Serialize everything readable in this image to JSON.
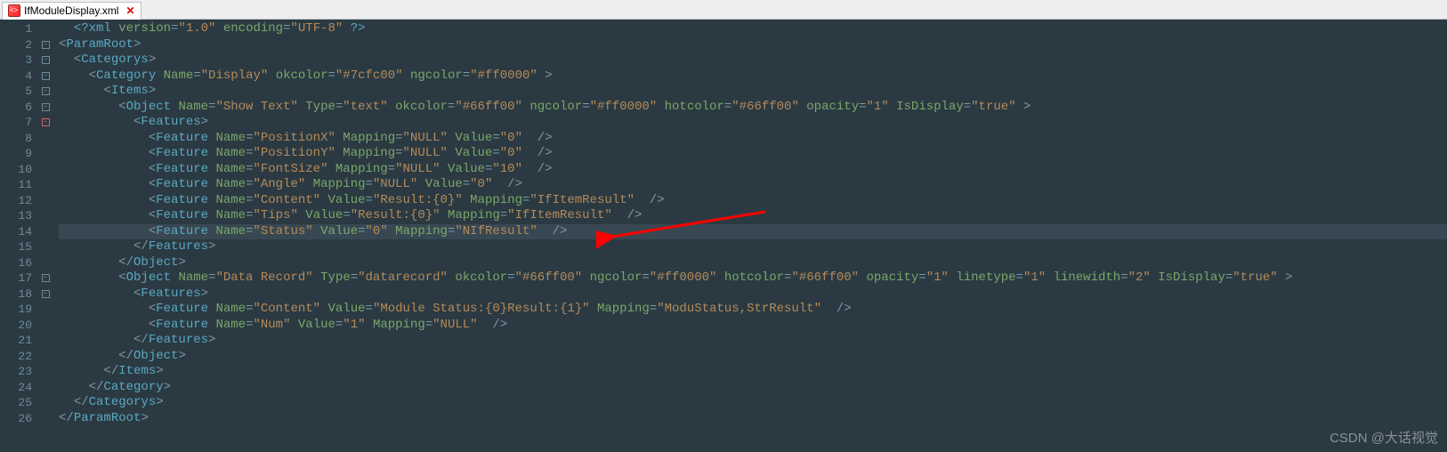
{
  "tab": {
    "filename": "IfModuleDisplay.xml",
    "close": "✕"
  },
  "lineNumbers": [
    "1",
    "2",
    "3",
    "4",
    "5",
    "6",
    "7",
    "8",
    "9",
    "10",
    "11",
    "12",
    "13",
    "14",
    "15",
    "16",
    "17",
    "18",
    "19",
    "20",
    "21",
    "22",
    "23",
    "24",
    "25",
    "26"
  ],
  "fold": [
    "",
    "⊟",
    "⊟",
    "⊟",
    "⊟",
    "⊟",
    "⊟",
    "",
    "",
    "",
    "",
    "",
    "",
    "",
    "",
    "",
    "⊟",
    "⊟",
    "",
    "",
    "",
    "",
    "",
    "",
    "",
    ""
  ],
  "highlightLine": 14,
  "code": {
    "l1": {
      "pre": "  ",
      "xml": "<?xml ",
      "a1": "version",
      "v1": "\"1.0\"",
      "a2": "encoding",
      "v2": "\"UTF-8\"",
      "end": "?>"
    },
    "l2": {
      "open": "<",
      "tag": "ParamRoot",
      "close": ">"
    },
    "l3": {
      "indent": "  ",
      "open": "<",
      "tag": "Categorys",
      "close": ">"
    },
    "l4": {
      "indent": "    ",
      "open": "<",
      "tag": "Category ",
      "a1": "Name",
      "v1": "\"Display\"",
      "a2": "okcolor",
      "v2": "\"#7cfc00\"",
      "a3": "ngcolor",
      "v3": "\"#ff0000\"",
      "close": ">"
    },
    "l5": {
      "indent": "      ",
      "open": "<",
      "tag": "Items",
      "close": ">"
    },
    "l6": {
      "indent": "        ",
      "open": "<",
      "tag": "Object ",
      "a1": "Name",
      "v1": "\"Show Text\"",
      "a2": "Type",
      "v2": "\"text\"",
      "a3": "okcolor",
      "v3": "\"#66ff00\"",
      "a4": "ngcolor",
      "v4": "\"#ff0000\"",
      "a5": "hotcolor",
      "v5": "\"#66ff00\"",
      "a6": "opacity",
      "v6": "\"1\"",
      "a7": "IsDisplay",
      "v7": "\"true\"",
      "close": ">"
    },
    "l7": {
      "indent": "          ",
      "open": "<",
      "tag": "Features",
      "close": ">"
    },
    "l8": {
      "indent": "            ",
      "open": "<",
      "tag": "Feature ",
      "a1": "Name",
      "v1": "\"PositionX\"",
      "a2": "Mapping",
      "v2": "\"NULL\"",
      "a3": "Value",
      "v3": "\"0\"",
      "sc": " />"
    },
    "l9": {
      "indent": "            ",
      "open": "<",
      "tag": "Feature ",
      "a1": "Name",
      "v1": "\"PositionY\"",
      "a2": "Mapping",
      "v2": "\"NULL\"",
      "a3": "Value",
      "v3": "\"0\"",
      "sc": " />"
    },
    "l10": {
      "indent": "            ",
      "open": "<",
      "tag": "Feature ",
      "a1": "Name",
      "v1": "\"FontSize\"",
      "a2": "Mapping",
      "v2": "\"NULL\"",
      "a3": "Value",
      "v3": "\"10\"",
      "sc": " />"
    },
    "l11": {
      "indent": "            ",
      "open": "<",
      "tag": "Feature ",
      "a1": "Name",
      "v1": "\"Angle\"",
      "a2": "Mapping",
      "v2": "\"NULL\"",
      "a3": "Value",
      "v3": "\"0\"",
      "sc": " />"
    },
    "l12": {
      "indent": "            ",
      "open": "<",
      "tag": "Feature ",
      "a1": "Name",
      "v1": "\"Content\"",
      "a2": "Value",
      "v2": "\"Result:{0}\"",
      "a3": "Mapping",
      "v3": "\"IfItemResult\"",
      "sc": " />"
    },
    "l13": {
      "indent": "            ",
      "open": "<",
      "tag": "Feature ",
      "a1": "Name",
      "v1": "\"Tips\"",
      "a2": "Value",
      "v2": "\"Result:{0}\"",
      "a3": "Mapping",
      "v3": "\"IfItemResult\"",
      "sc": " />"
    },
    "l14": {
      "indent": "            ",
      "open": "<",
      "tag": "Feature ",
      "a1": "Name",
      "v1": "\"Status\"",
      "a2": "Value",
      "v2": "\"0\"",
      "a3": "Mapping",
      "v3": "\"NIfResult\"",
      "sc": " />"
    },
    "l15": {
      "indent": "          ",
      "open": "</",
      "tag": "Features",
      "close": ">"
    },
    "l16": {
      "indent": "        ",
      "open": "</",
      "tag": "Object",
      "close": ">"
    },
    "l17": {
      "indent": "        ",
      "open": "<",
      "tag": "Object ",
      "a1": "Name",
      "v1": "\"Data Record\"",
      "a2": "Type",
      "v2": "\"datarecord\"",
      "a3": "okcolor",
      "v3": "\"#66ff00\"",
      "a4": "ngcolor",
      "v4": "\"#ff0000\"",
      "a5": "hotcolor",
      "v5": "\"#66ff00\"",
      "a6": "opacity",
      "v6": "\"1\"",
      "a7": "linetype",
      "v7": "\"1\"",
      "a8": "linewidth",
      "v8": "\"2\"",
      "a9": "IsDisplay",
      "v9": "\"true\"",
      "close": ">"
    },
    "l18": {
      "indent": "          ",
      "open": "<",
      "tag": "Features",
      "close": ">"
    },
    "l19": {
      "indent": "            ",
      "open": "<",
      "tag": "Feature ",
      "a1": "Name",
      "v1": "\"Content\"",
      "a2": "Value",
      "v2": "\"Module Status:{0}Result:{1}\"",
      "a3": "Mapping",
      "v3": "\"ModuStatus,StrResult\"",
      "sc": " />"
    },
    "l20": {
      "indent": "            ",
      "open": "<",
      "tag": "Feature ",
      "a1": "Name",
      "v1": "\"Num\"",
      "a2": "Value",
      "v2": "\"1\"",
      "a3": "Mapping",
      "v3": "\"NULL\"",
      "sc": " />"
    },
    "l21": {
      "indent": "          ",
      "open": "</",
      "tag": "Features",
      "close": ">"
    },
    "l22": {
      "indent": "        ",
      "open": "</",
      "tag": "Object",
      "close": ">"
    },
    "l23": {
      "indent": "      ",
      "open": "</",
      "tag": "Items",
      "close": ">"
    },
    "l24": {
      "indent": "    ",
      "open": "</",
      "tag": "Category",
      "close": ">"
    },
    "l25": {
      "indent": "  ",
      "open": "</",
      "tag": "Categorys",
      "close": ">"
    },
    "l26": {
      "open": "</",
      "tag": "ParamRoot",
      "close": ">"
    }
  },
  "watermark": "CSDN @大话视觉"
}
